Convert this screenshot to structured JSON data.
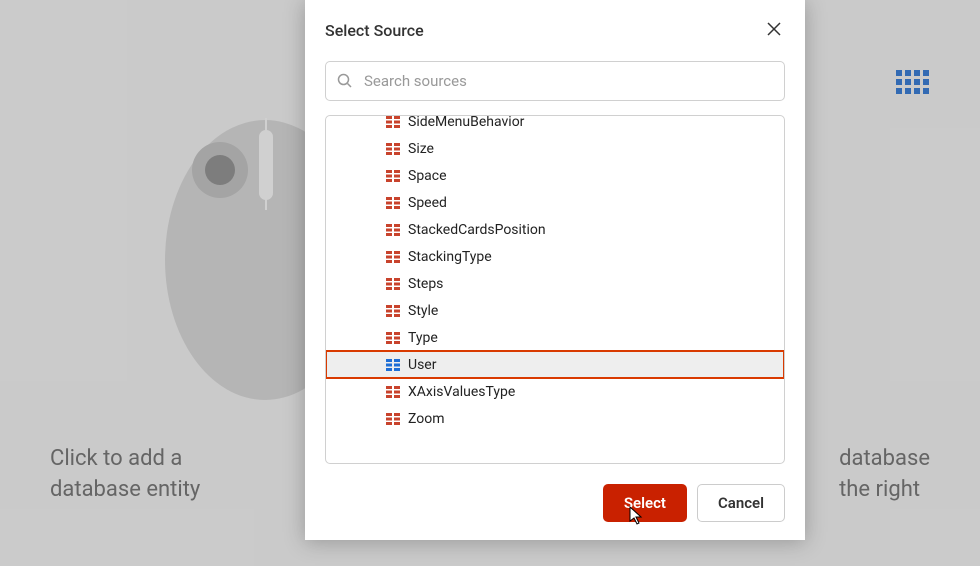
{
  "backdrop": {
    "left_text_line1": "Click to add a",
    "left_text_line2": "database entity",
    "right_text_line1": "database",
    "right_text_line2": "the right"
  },
  "modal": {
    "title": "Select Source",
    "search_placeholder": "Search sources",
    "items": [
      {
        "label": "SideMenuBehavior",
        "selected": false,
        "cls": "partial-top"
      },
      {
        "label": "Size",
        "selected": false,
        "cls": ""
      },
      {
        "label": "Space",
        "selected": false,
        "cls": ""
      },
      {
        "label": "Speed",
        "selected": false,
        "cls": ""
      },
      {
        "label": "StackedCardsPosition",
        "selected": false,
        "cls": ""
      },
      {
        "label": "StackingType",
        "selected": false,
        "cls": ""
      },
      {
        "label": "Steps",
        "selected": false,
        "cls": ""
      },
      {
        "label": "Style",
        "selected": false,
        "cls": ""
      },
      {
        "label": "Type",
        "selected": false,
        "cls": ""
      },
      {
        "label": "User",
        "selected": true,
        "cls": ""
      },
      {
        "label": "XAxisValuesType",
        "selected": false,
        "cls": ""
      },
      {
        "label": "Zoom",
        "selected": false,
        "cls": ""
      }
    ],
    "select_button": "Select",
    "cancel_button": "Cancel"
  }
}
